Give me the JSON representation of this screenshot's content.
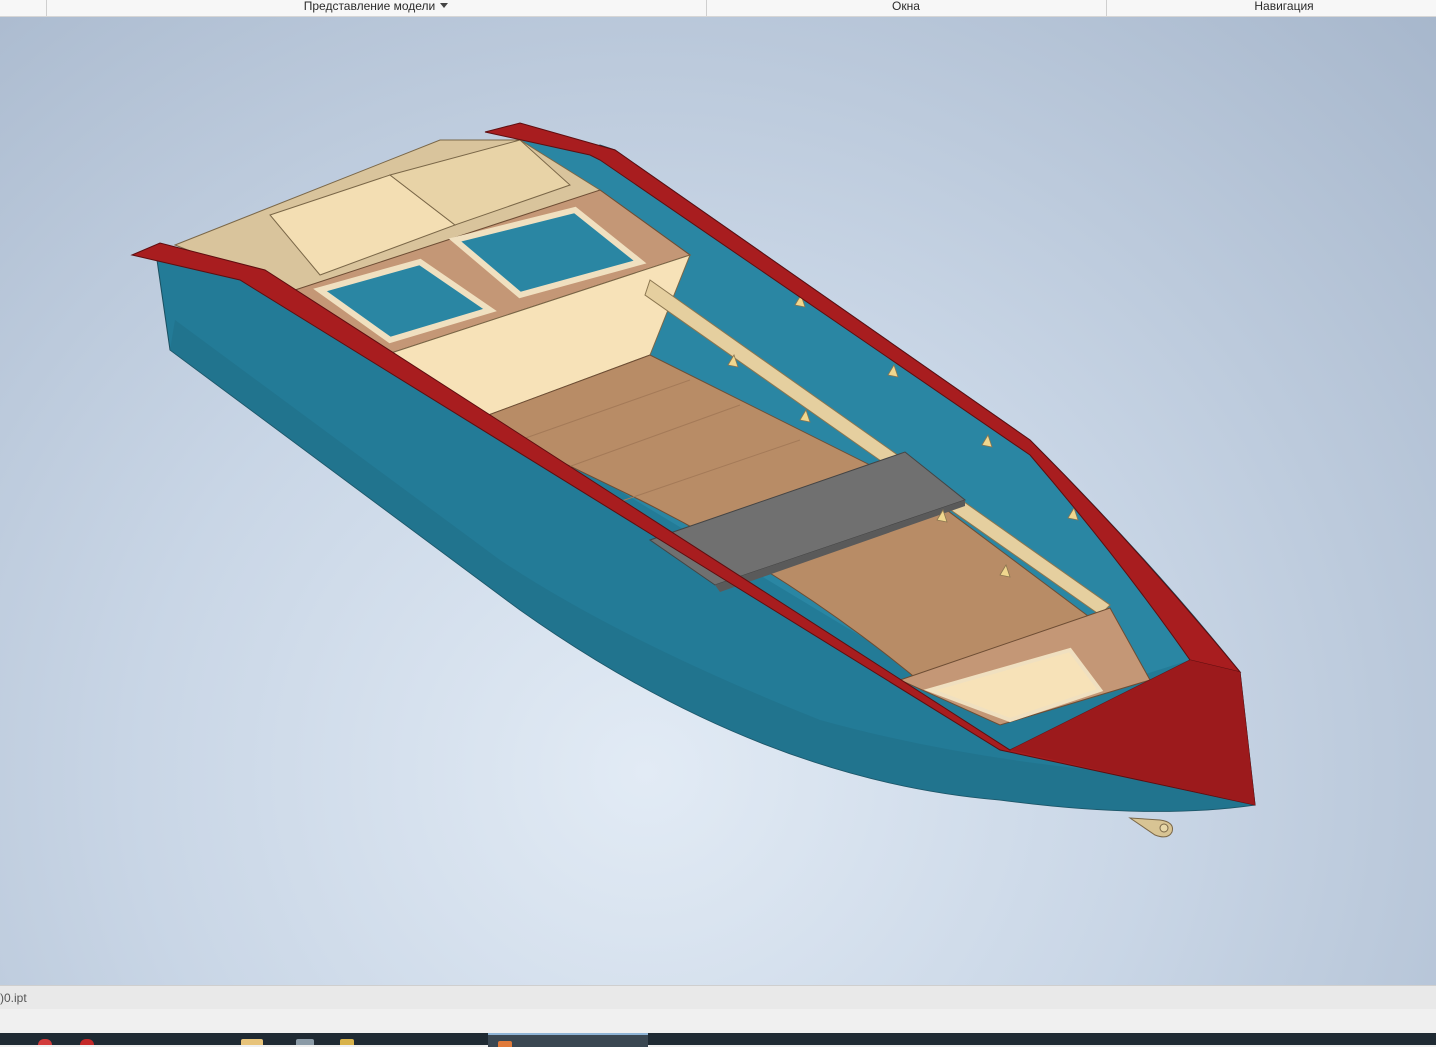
{
  "ribbon": {
    "groups": [
      {
        "label": "Представление модели",
        "has_dropdown": true
      },
      {
        "label": "Окна",
        "has_dropdown": false
      },
      {
        "label": "Навигация",
        "has_dropdown": false
      }
    ]
  },
  "status_bar": {
    "document_name": ")0.ipt"
  },
  "taskbar": {
    "items": [
      "app-icon-red",
      "app-icon-red-2",
      "folder-icon",
      "app-icon",
      "app-icon-2",
      "inventor-app-icon"
    ]
  },
  "colors": {
    "hull": "#237b97",
    "gunwale": "#a81d1f",
    "plywood": "#f5ddb0",
    "floor": "#b88c66",
    "seat": "#707070",
    "background_center": "#e2ebf5",
    "background_edge": "#a7b7cc"
  }
}
